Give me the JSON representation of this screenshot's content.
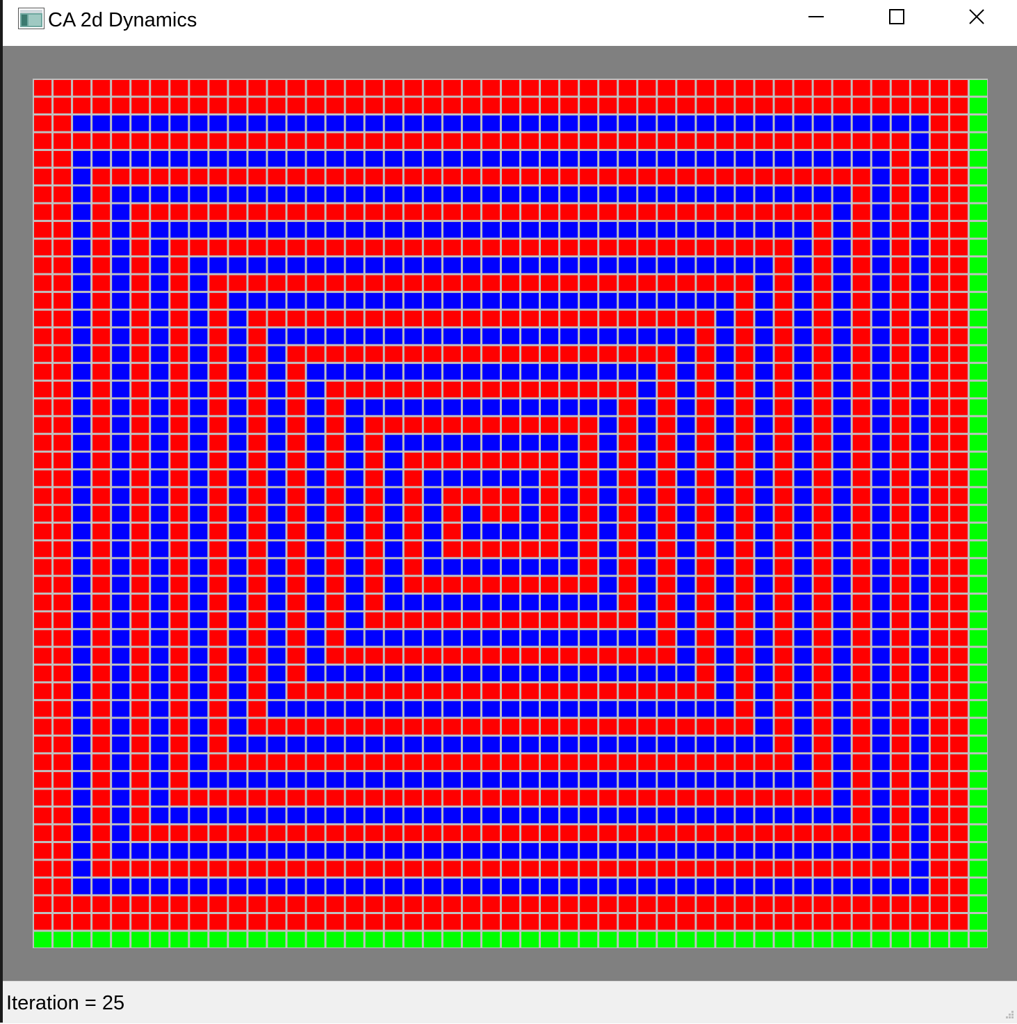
{
  "window": {
    "title": "CA 2d Dynamics",
    "icon": "app-window-icon",
    "controls": {
      "minimize": "minimize-icon",
      "maximize": "maximize-icon",
      "close": "close-icon"
    }
  },
  "automaton": {
    "rows": 49,
    "cols": 49,
    "colors": {
      "red": "#ff0000",
      "blue": "#0000ff",
      "green": "#00ff00",
      "gridline": "#c0c0c0",
      "background": "#808080"
    },
    "pattern": "square spiral of alternating red and blue cells; bottom row and right column green"
  },
  "status": {
    "iteration_text": "Iteration = 25"
  }
}
